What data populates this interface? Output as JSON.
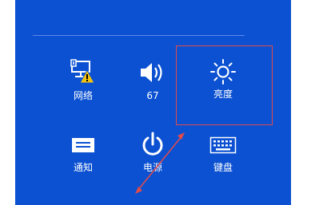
{
  "tiles": {
    "network": {
      "label": "网络",
      "icon": "network-warning-icon"
    },
    "volume": {
      "label": "67",
      "icon": "speaker-icon"
    },
    "brightness": {
      "label": "亮度",
      "icon": "brightness-icon"
    },
    "notifications": {
      "label": "通知",
      "icon": "notification-icon"
    },
    "power": {
      "label": "电源",
      "icon": "power-icon"
    },
    "keyboard": {
      "label": "键盘",
      "icon": "keyboard-icon"
    }
  },
  "colors": {
    "panel": "#0b51d2",
    "highlight": "#e14b4b",
    "warning": "#f3c20d"
  }
}
